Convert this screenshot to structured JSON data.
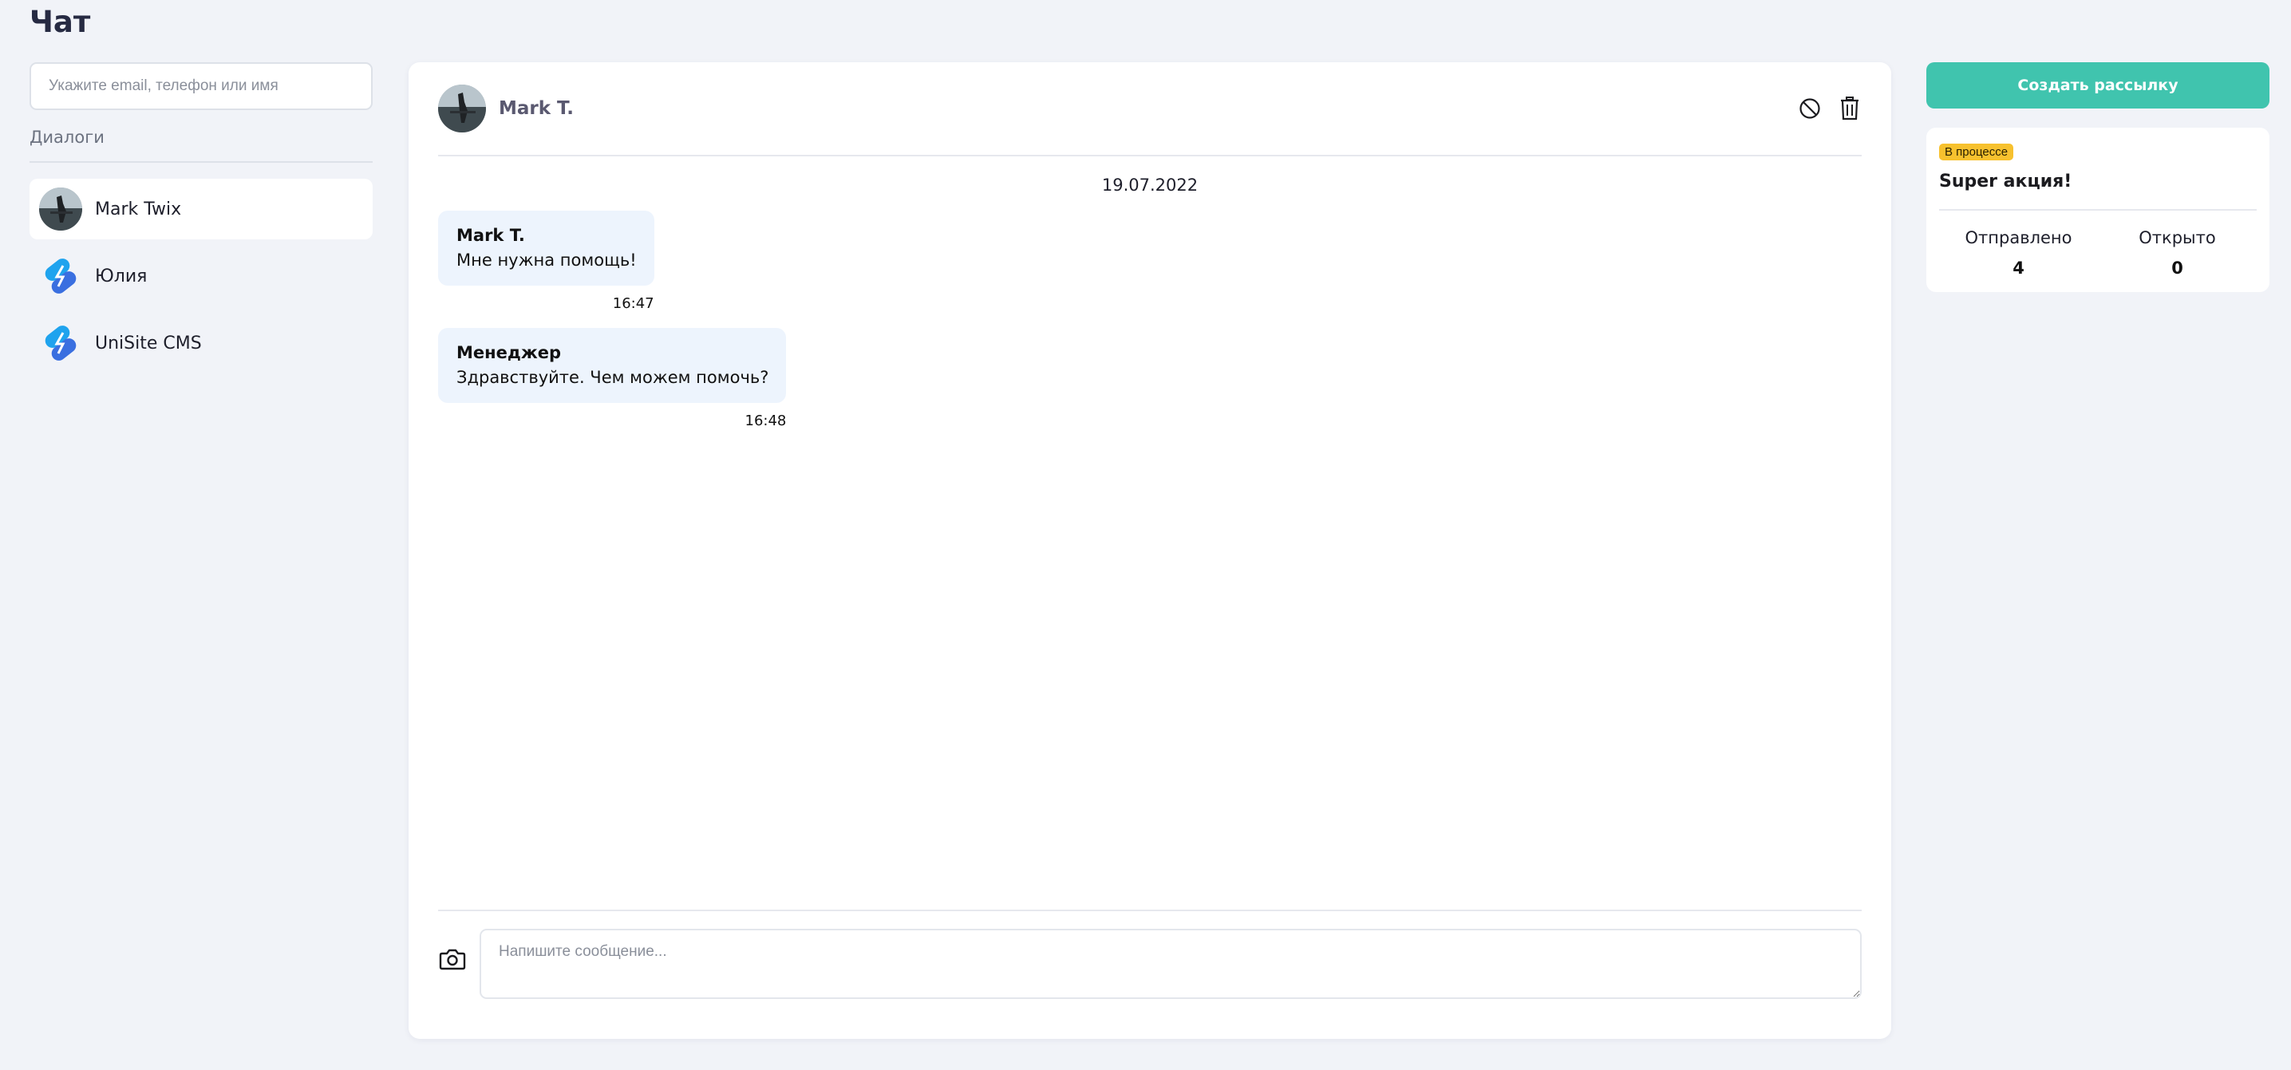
{
  "page": {
    "title": "Чат"
  },
  "sidebar": {
    "search_placeholder": "Укажите email, телефон или имя",
    "dialogs_label": "Диалоги",
    "dialogs": [
      {
        "name": "Mark Twix",
        "avatar": "photo-avatar",
        "active": true
      },
      {
        "name": "Юлия",
        "avatar": "unisite-logo-icon",
        "active": false
      },
      {
        "name": "UniSite CMS",
        "avatar": "unisite-logo-icon",
        "active": false
      }
    ]
  },
  "chat": {
    "header": {
      "name": "Mark T."
    },
    "actions": [
      "block-icon",
      "trash-icon"
    ],
    "date": "19.07.2022",
    "messages": [
      {
        "author": "Mark T.",
        "text": "Мне нужна помощь!",
        "time": "16:47"
      },
      {
        "author": "Менеджер",
        "text": "Здравствуйте. Чем можем помочь?",
        "time": "16:48"
      }
    ],
    "composer": {
      "placeholder": "Напишите сообщение...",
      "value": ""
    }
  },
  "right": {
    "create_button": "Создать рассылку",
    "campaign": {
      "status": "В процессе",
      "title": "Super акция!",
      "sent_label": "Отправлено",
      "sent_value": "4",
      "opened_label": "Открыто",
      "opened_value": "0"
    }
  },
  "colors": {
    "accent": "#40c4ae",
    "badge": "#f7c12e",
    "bubble": "#edf4fd",
    "background": "#f1f3f8"
  }
}
